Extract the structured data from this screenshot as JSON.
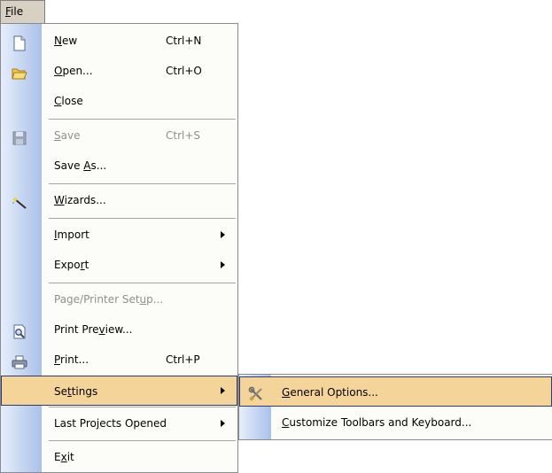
{
  "menubar": {
    "file": {
      "pre": "",
      "u": "F",
      "post": "ile"
    }
  },
  "menu": {
    "new": {
      "pre": "",
      "u": "N",
      "post": "ew",
      "shortcut": "Ctrl+N"
    },
    "open": {
      "pre": "",
      "u": "O",
      "post": "pen...",
      "shortcut": "Ctrl+O"
    },
    "close": {
      "pre": "",
      "u": "C",
      "post": "lose"
    },
    "save": {
      "pre": "",
      "u": "S",
      "post": "ave",
      "shortcut": "Ctrl+S"
    },
    "save_as": {
      "pre": "Save ",
      "u": "A",
      "post": "s..."
    },
    "wizards": {
      "pre": "",
      "u": "W",
      "post": "izards..."
    },
    "import": {
      "pre": "",
      "u": "I",
      "post": "mport"
    },
    "export": {
      "pre": "Expo",
      "u": "r",
      "post": "t"
    },
    "page_setup": {
      "pre": "Page/Printer Set",
      "u": "u",
      "post": "p..."
    },
    "print_preview": {
      "pre": "Print Pre",
      "u": "v",
      "post": "iew..."
    },
    "print": {
      "pre": "",
      "u": "P",
      "post": "rint...",
      "shortcut": "Ctrl+P"
    },
    "settings": {
      "pre": "Se",
      "u": "t",
      "post": "tings"
    },
    "last_projects": {
      "pre": "Last Pro",
      "u": "j",
      "post": "ects Opened"
    },
    "exit": {
      "pre": "E",
      "u": "x",
      "post": "it"
    }
  },
  "submenu": {
    "general_options": {
      "pre": "",
      "u": "G",
      "post": "eneral Options..."
    },
    "customize": {
      "pre": "",
      "u": "C",
      "post": "ustomize Toolbars and Keyboard..."
    }
  },
  "icons": {
    "new": "new-document-icon",
    "open": "open-folder-icon",
    "save": "save-disk-icon",
    "wizards": "wizard-wand-icon",
    "print_preview": "print-preview-icon",
    "print": "printer-icon",
    "general_options": "tools-icon"
  },
  "colors": {
    "highlight": "#f5d49a",
    "highlight_border": "#2c3c6f",
    "gutter_start": "#e6eefb",
    "gutter_end": "#a9c1ea",
    "menu_bg": "#fcfcf9",
    "disabled_text": "#8f8f8f"
  }
}
